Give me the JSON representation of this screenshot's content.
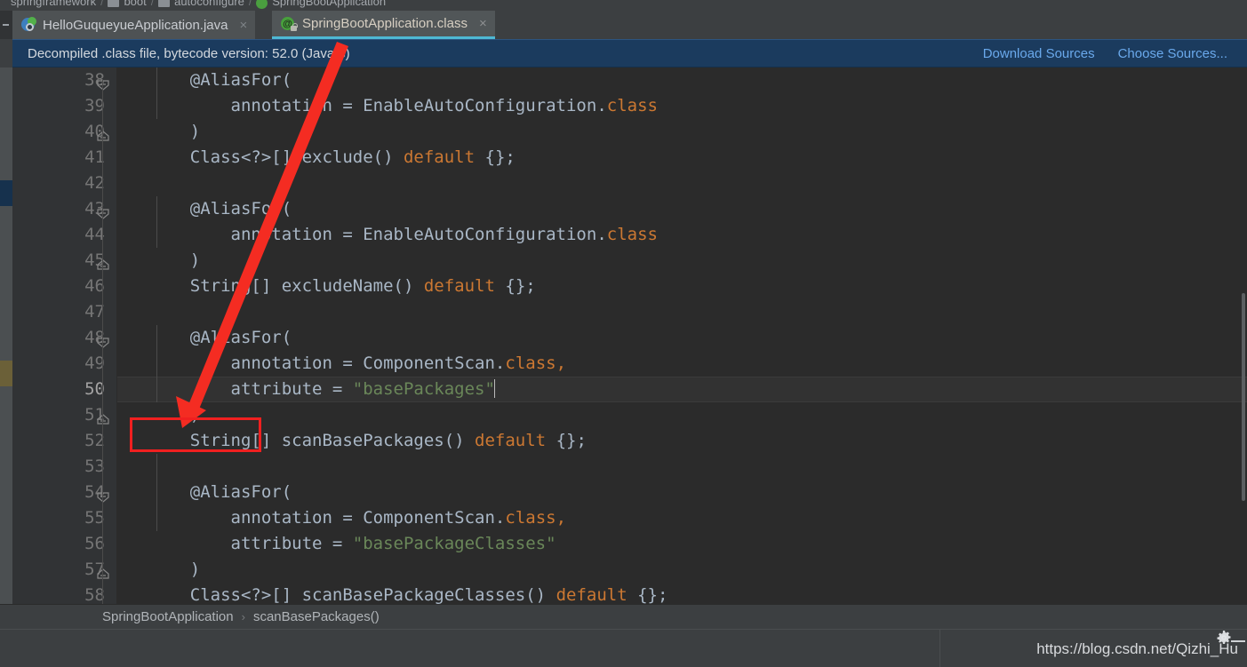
{
  "window": {
    "top_breadcrumb": [
      {
        "label": "springframework",
        "icon": "package-icon"
      },
      {
        "label": "boot",
        "icon": "package-icon"
      },
      {
        "label": "autoconfigure",
        "icon": "package-icon"
      },
      {
        "label": "SpringBootApplication",
        "icon": "annotation-class-icon"
      }
    ]
  },
  "tabs": [
    {
      "label": "HelloGuqueyueApplication.java",
      "icon": "java-class-icon",
      "close": "×",
      "active": false
    },
    {
      "label": "SpringBootApplication.class",
      "icon": "annotation-class-icon",
      "close": "×",
      "active": true
    }
  ],
  "infobar": {
    "message": "Decompiled .class file, bytecode version: 52.0 (Java 8)",
    "download_sources": "Download Sources",
    "choose_sources": "Choose Sources...",
    "background": "#1b3b5e",
    "link_color": "#6aa9ec"
  },
  "editor": {
    "current_line": 50,
    "first_line": 38,
    "theme": {
      "background": "#2b2b2b",
      "gutter": "#313335",
      "text": "#a9b7c6",
      "keyword": "#cc7832",
      "string": "#6a8759",
      "linenumber": "#757575"
    },
    "lines": [
      {
        "n": 38,
        "fold": "open",
        "tokens": [
          {
            "t": "    @AliasFor(",
            "c": "plain"
          }
        ]
      },
      {
        "n": 39,
        "fold": "none",
        "tokens": [
          {
            "t": "        annotation = EnableAutoConfiguration.",
            "c": "plain"
          },
          {
            "t": "class",
            "c": "kw"
          }
        ]
      },
      {
        "n": 40,
        "fold": "close",
        "tokens": [
          {
            "t": "    )",
            "c": "plain"
          }
        ]
      },
      {
        "n": 41,
        "fold": "none",
        "tokens": [
          {
            "t": "    Class<?>[] exclude() ",
            "c": "plain"
          },
          {
            "t": "default",
            "c": "kw"
          },
          {
            "t": " {};",
            "c": "plain"
          }
        ]
      },
      {
        "n": 42,
        "fold": "none",
        "tokens": [
          {
            "t": "",
            "c": "plain"
          }
        ]
      },
      {
        "n": 43,
        "fold": "open",
        "tokens": [
          {
            "t": "    @AliasFor(",
            "c": "plain"
          }
        ]
      },
      {
        "n": 44,
        "fold": "none",
        "tokens": [
          {
            "t": "        annotation = EnableAutoConfiguration.",
            "c": "plain"
          },
          {
            "t": "class",
            "c": "kw"
          }
        ]
      },
      {
        "n": 45,
        "fold": "close",
        "tokens": [
          {
            "t": "    )",
            "c": "plain"
          }
        ]
      },
      {
        "n": 46,
        "fold": "none",
        "tokens": [
          {
            "t": "    String[] excludeName() ",
            "c": "plain"
          },
          {
            "t": "default",
            "c": "kw"
          },
          {
            "t": " {};",
            "c": "plain"
          }
        ]
      },
      {
        "n": 47,
        "fold": "none",
        "tokens": [
          {
            "t": "",
            "c": "plain"
          }
        ]
      },
      {
        "n": 48,
        "fold": "open",
        "tokens": [
          {
            "t": "    @AliasFor(",
            "c": "plain"
          }
        ]
      },
      {
        "n": 49,
        "fold": "none",
        "tokens": [
          {
            "t": "        annotation = ComponentScan.",
            "c": "plain"
          },
          {
            "t": "class,",
            "c": "kw"
          }
        ]
      },
      {
        "n": 50,
        "fold": "none",
        "tokens": [
          {
            "t": "        attribute = ",
            "c": "plain"
          },
          {
            "t": "\"basePackages\"",
            "c": "str"
          }
        ],
        "caret": true,
        "highlight": true
      },
      {
        "n": 51,
        "fold": "close",
        "tokens": [
          {
            "t": "    )",
            "c": "plain"
          }
        ]
      },
      {
        "n": 52,
        "fold": "none",
        "tokens": [
          {
            "t": "    String[] scanBasePackages() ",
            "c": "plain"
          },
          {
            "t": "default",
            "c": "kw"
          },
          {
            "t": " {};",
            "c": "plain"
          }
        ]
      },
      {
        "n": 53,
        "fold": "none",
        "tokens": [
          {
            "t": "",
            "c": "plain"
          }
        ]
      },
      {
        "n": 54,
        "fold": "open",
        "tokens": [
          {
            "t": "    @AliasFor(",
            "c": "plain"
          }
        ]
      },
      {
        "n": 55,
        "fold": "none",
        "tokens": [
          {
            "t": "        annotation = ComponentScan.",
            "c": "plain"
          },
          {
            "t": "class,",
            "c": "kw"
          }
        ]
      },
      {
        "n": 56,
        "fold": "none",
        "tokens": [
          {
            "t": "        attribute = ",
            "c": "plain"
          },
          {
            "t": "\"basePackageClasses\"",
            "c": "str"
          }
        ]
      },
      {
        "n": 57,
        "fold": "close",
        "tokens": [
          {
            "t": "    )",
            "c": "plain"
          }
        ]
      },
      {
        "n": 58,
        "fold": "none",
        "tokens": [
          {
            "t": "    Class<?>[] scanBasePackageClasses() ",
            "c": "plain"
          },
          {
            "t": "default",
            "c": "kw"
          },
          {
            "t": " {};",
            "c": "plain"
          }
        ]
      }
    ]
  },
  "bottom_breadcrumb": {
    "items": [
      "SpringBootApplication",
      "scanBasePackages()"
    ],
    "separator": "›"
  },
  "statusbar": {
    "watermark": "https://blog.csdn.net/Qizhi_Hu",
    "gear": "gear-icon",
    "minimize": "minimize-icon"
  },
  "annotation": {
    "highlight_color": "#f02020",
    "box_target": "String[]",
    "arrow": "red-arrow"
  }
}
